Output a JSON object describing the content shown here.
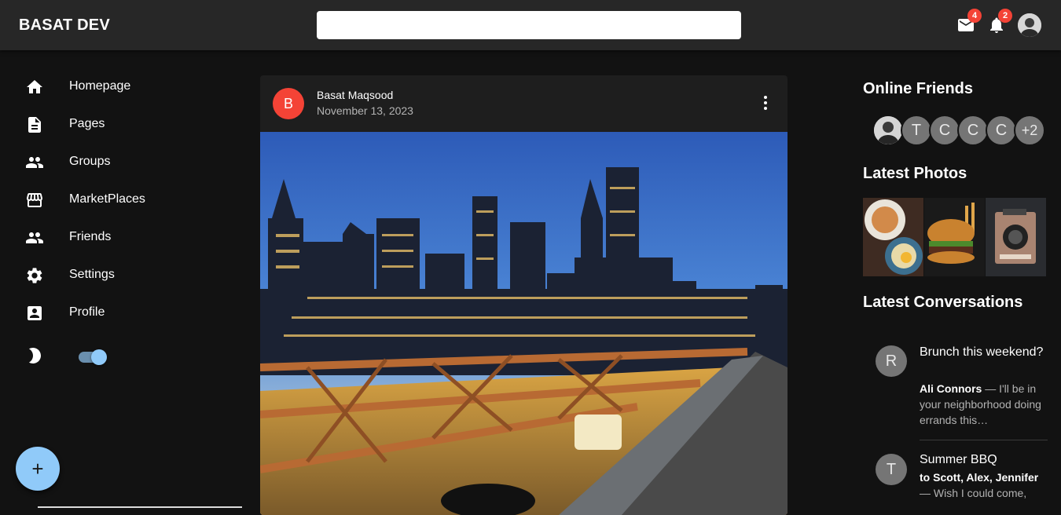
{
  "app": {
    "brand": "BASAT DEV"
  },
  "header": {
    "search_placeholder": "",
    "mail_count": "4",
    "notification_count": "2"
  },
  "sidebar": {
    "items": [
      {
        "label": "Homepage",
        "icon": "home-icon"
      },
      {
        "label": "Pages",
        "icon": "article-icon"
      },
      {
        "label": "Groups",
        "icon": "groups-icon"
      },
      {
        "label": "MarketPlaces",
        "icon": "storefront-icon"
      },
      {
        "label": "Friends",
        "icon": "people-icon"
      },
      {
        "label": "Settings",
        "icon": "gear-icon"
      },
      {
        "label": "Profile",
        "icon": "account-box-icon"
      }
    ],
    "theme_toggle_on": true,
    "fab_label": "+"
  },
  "post": {
    "avatar_letter": "B",
    "author": "Basat Maqsood",
    "date": "November 13, 2023"
  },
  "right": {
    "online_friends_title": "Online Friends",
    "online_friends": [
      "T",
      "C",
      "C",
      "C"
    ],
    "online_more": "+2",
    "latest_photos_title": "Latest Photos",
    "latest_conversations_title": "Latest Conversations",
    "conversations": [
      {
        "avatar": "R",
        "title": "Brunch this weekend?",
        "sender": "Ali Connors",
        "preview": " — I'll be in your neighborhood doing errands this…"
      },
      {
        "avatar": "T",
        "title": "Summer BBQ",
        "sender": "to Scott, Alex, Jennifer",
        "preview": "— Wish I could come,"
      }
    ]
  },
  "colors": {
    "background": "#121212",
    "appbar": "#272727",
    "card": "#1e1e1e",
    "accent": "#90caf9",
    "badge": "#f44336",
    "post_avatar": "#f44336"
  }
}
